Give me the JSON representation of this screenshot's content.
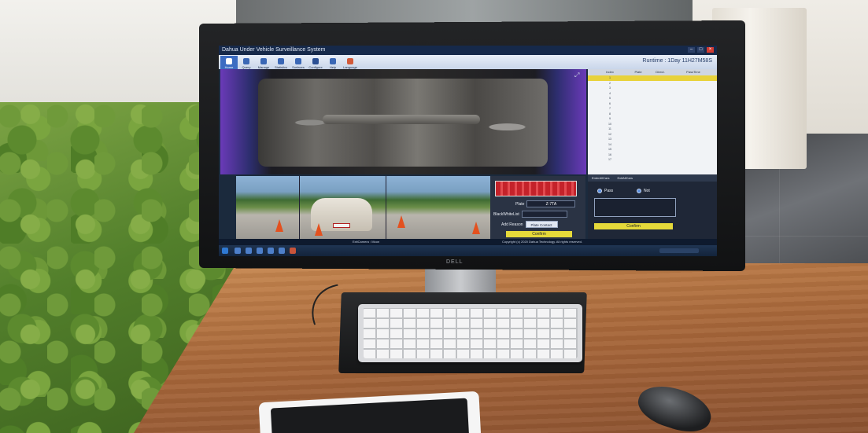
{
  "app": {
    "title": "Dahua Under Vehicle Surveillance System",
    "runtime": "Runtime : 1Day 11H27M58S"
  },
  "toolbar": {
    "items": [
      "Home",
      "Query",
      "Manage",
      "Statistics",
      "Surfaces",
      "Configure",
      "Help",
      "Language"
    ]
  },
  "records": {
    "headers": [
      "Index",
      "Plate",
      "Direct.",
      "PassTime"
    ],
    "rows": [
      [
        "1",
        "",
        "",
        ""
      ],
      [
        "2",
        "",
        "",
        ""
      ],
      [
        "3",
        "",
        "",
        ""
      ],
      [
        "4",
        "",
        "",
        ""
      ],
      [
        "5",
        "",
        "",
        ""
      ],
      [
        "6",
        "",
        "",
        ""
      ],
      [
        "7",
        "",
        "",
        ""
      ],
      [
        "8",
        "",
        "",
        ""
      ],
      [
        "9",
        "",
        "",
        ""
      ],
      [
        "10",
        "",
        "",
        ""
      ],
      [
        "11",
        "",
        "",
        ""
      ],
      [
        "12",
        "",
        "",
        ""
      ],
      [
        "13",
        "",
        "",
        ""
      ],
      [
        "14",
        "",
        "",
        ""
      ],
      [
        "15",
        "",
        "",
        ""
      ],
      [
        "16",
        "",
        "",
        ""
      ],
      [
        "17",
        "",
        "",
        ""
      ]
    ]
  },
  "plate_panel": {
    "plate_label": "Plate",
    "plate_value": "Z-7TA",
    "blacklist_label": "BlackWhiteList",
    "add_reason_label": "Add Reason",
    "plate_contact_button": "Plate Contact",
    "confirm_button": "Confirm"
  },
  "control_panel": {
    "tabs": [
      "EnterAllCars",
      "ExitAllCars"
    ],
    "pass_label": "Pass",
    "not_label": "Not",
    "confirm_button": "Confirm"
  },
  "status_bar": {
    "camera": "ExitCamera : Moon",
    "copyright": "Copyright (c) 2020 Dahua Technology. All rights reserved."
  },
  "monitor": {
    "brand": "DELL"
  },
  "colors": {
    "accent": "#3c6cc2",
    "selected_row": "#e8d23a",
    "confirm": "#e5d93a",
    "close": "#d23b32"
  }
}
